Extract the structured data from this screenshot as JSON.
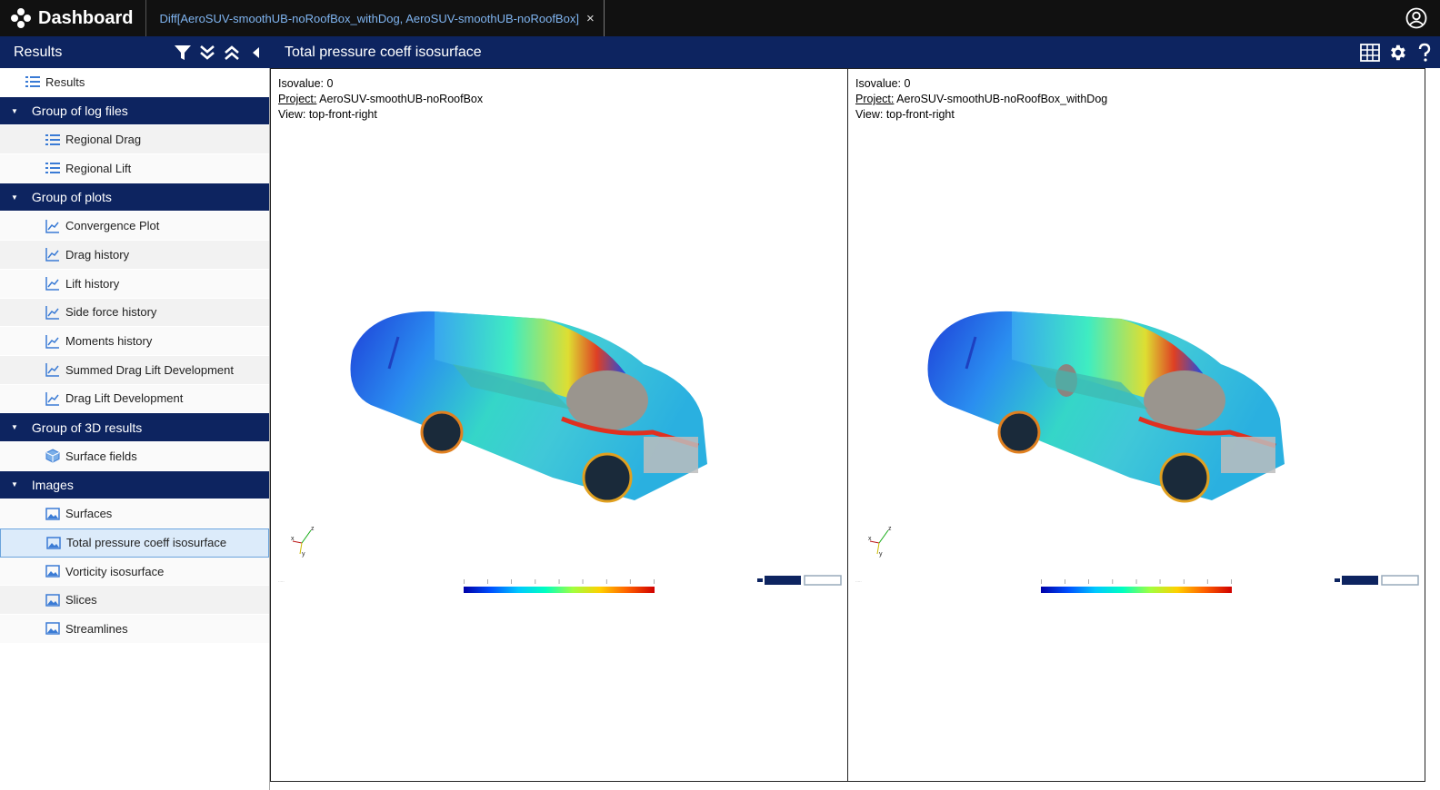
{
  "topbar": {
    "app_title": "Dashboard",
    "tab_label": "Diff[AeroSUV-smoothUB-noRoofBox_withDog, AeroSUV-smoothUB-noRoofBox]",
    "tab_close": "×"
  },
  "sidebar": {
    "title": "Results",
    "root": "Results",
    "groups": [
      {
        "label": "Group of log files",
        "items": [
          "Regional Drag",
          "Regional Lift"
        ]
      },
      {
        "label": "Group of plots",
        "items": [
          "Convergence Plot",
          "Drag history",
          "Lift history",
          "Side force history",
          "Moments history",
          "Summed Drag Lift Development",
          "Drag Lift Development"
        ]
      },
      {
        "label": "Group of 3D results",
        "items": [
          "Surface fields"
        ]
      },
      {
        "label": "Images",
        "items": [
          "Surfaces",
          "Total pressure coeff isosurface",
          "Vorticity isosurface",
          "Slices",
          "Streamlines"
        ]
      }
    ]
  },
  "main": {
    "title": "Total pressure coeff isosurface"
  },
  "panels": {
    "left": {
      "isovalue": "Isovalue: 0",
      "project_label": "Project:",
      "project_value": " AeroSUV-smoothUB-noRoofBox",
      "view": "View: top-front-right"
    },
    "right": {
      "isovalue": "Isovalue: 0",
      "project_label": "Project:",
      "project_value": " AeroSUV-smoothUB-noRoofBox_withDog",
      "view": "View: top-front-right"
    }
  },
  "colors": {
    "header_bg": "#0d2460",
    "topbar_bg": "#111111",
    "tab_text": "#7fb4f0",
    "selected_bg": "#dcebfa"
  }
}
